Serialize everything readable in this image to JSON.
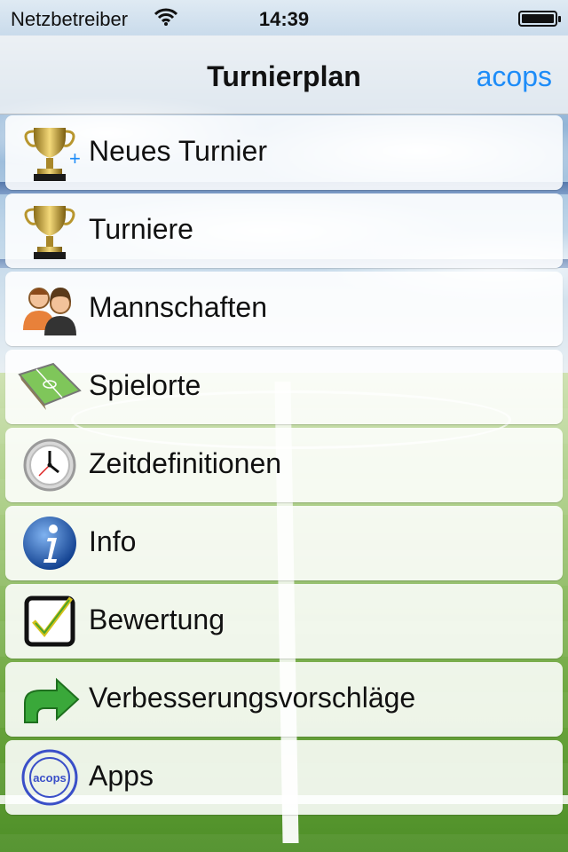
{
  "status_bar": {
    "carrier": "Netzbetreiber",
    "time": "14:39"
  },
  "nav": {
    "title": "Turnierplan",
    "right_button": "acops"
  },
  "menu": {
    "items": [
      {
        "label": "Neues Turnier",
        "icon": "trophy-add-icon"
      },
      {
        "label": "Turniere",
        "icon": "trophy-icon"
      },
      {
        "label": "Mannschaften",
        "icon": "team-icon"
      },
      {
        "label": "Spielorte",
        "icon": "pitch-icon"
      },
      {
        "label": "Zeitdefinitionen",
        "icon": "clock-icon"
      },
      {
        "label": "Info",
        "icon": "info-icon"
      },
      {
        "label": "Bewertung",
        "icon": "checkbox-icon"
      },
      {
        "label": "Verbesserungsvorschläge",
        "icon": "arrow-icon"
      },
      {
        "label": "Apps",
        "icon": "acops-stamp-icon"
      }
    ]
  },
  "stamp_text": "acops",
  "colors": {
    "accent": "#1d8cf8"
  }
}
